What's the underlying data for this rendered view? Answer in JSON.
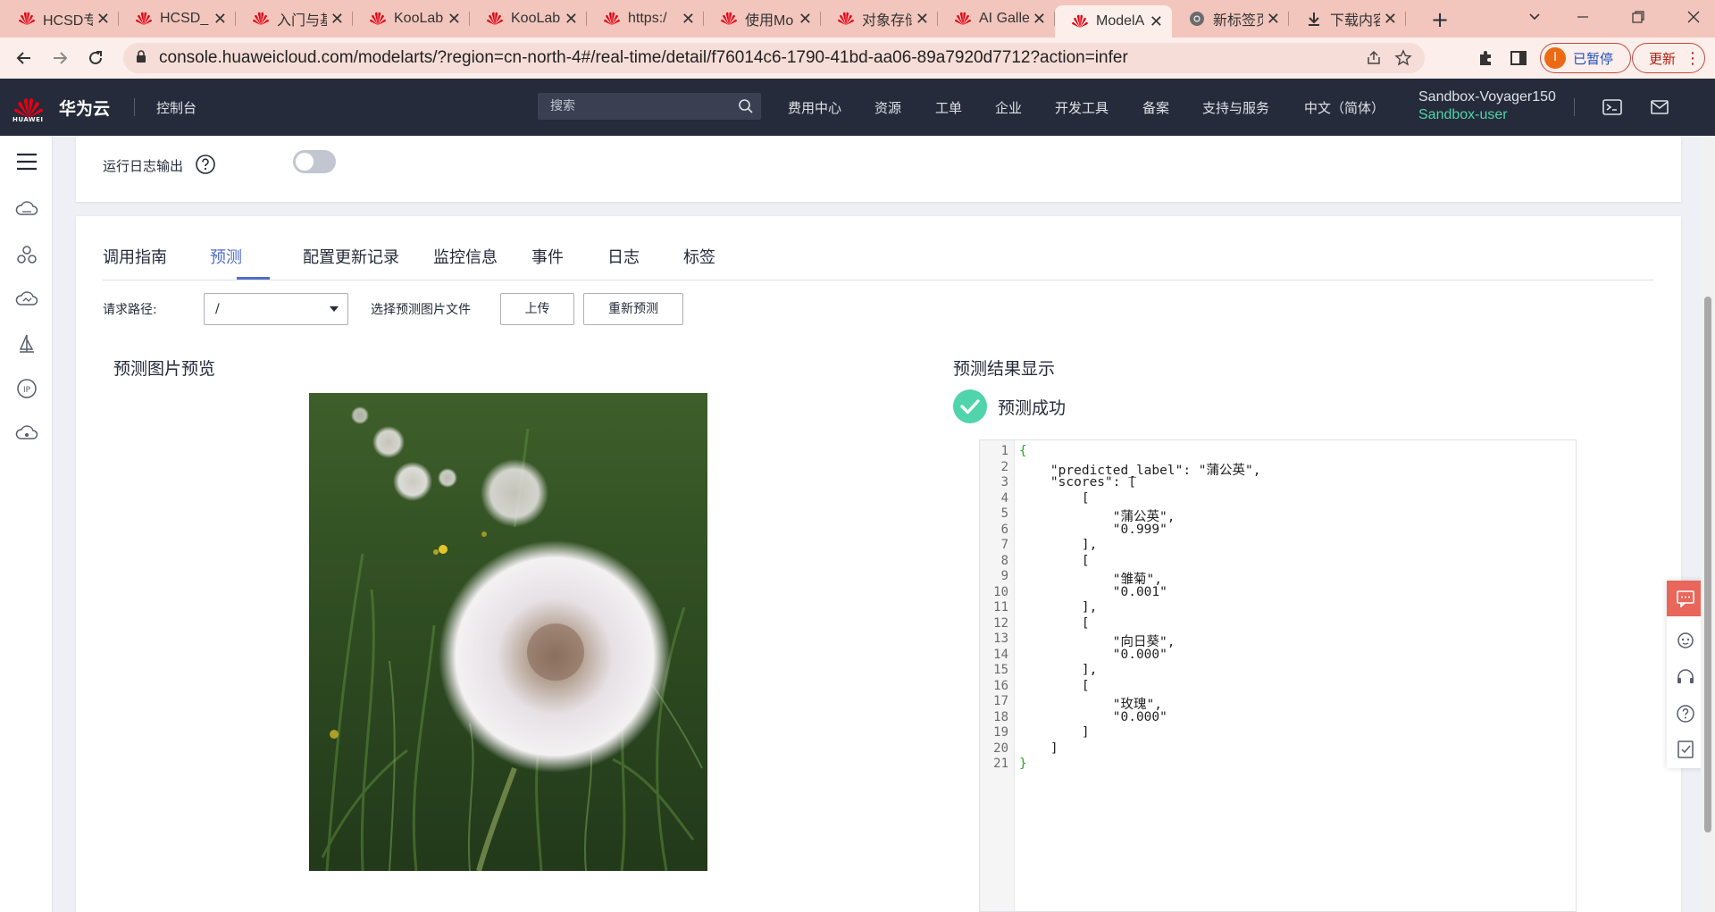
{
  "browser": {
    "tabs": [
      {
        "title": "HCSD专"
      },
      {
        "title": "HCSD_"
      },
      {
        "title": "入门与基"
      },
      {
        "title": "KooLab"
      },
      {
        "title": "KooLab"
      },
      {
        "title": "https:/"
      },
      {
        "title": "使用Mo"
      },
      {
        "title": "对象存储"
      },
      {
        "title": "AI Galle"
      },
      {
        "title": "ModelA"
      },
      {
        "title": "新标签页"
      },
      {
        "title": "下载内容"
      }
    ],
    "url": "console.huaweicloud.com/modelarts/?region=cn-north-4#/real-time/detail/f76014c6-1790-41bd-aa06-89a7920d7712?action=infer",
    "profile_initial": "I",
    "profile_status": "已暂停",
    "update_label": "更新"
  },
  "header": {
    "logo_text": "HUAWEI",
    "brand": "华为云",
    "console": "控制台",
    "search_placeholder": "搜索",
    "nav": [
      "费用中心",
      "资源",
      "工单",
      "企业",
      "开发工具",
      "备案",
      "支持与服务",
      "中文（简体）"
    ],
    "account_name": "Sandbox-Voyager150",
    "account_user": "Sandbox-user"
  },
  "log_output": {
    "label": "运行日志输出",
    "enabled": false
  },
  "tabs": [
    "调用指南",
    "预测",
    "配置更新记录",
    "监控信息",
    "事件",
    "日志",
    "标签"
  ],
  "active_tab": "预测",
  "request": {
    "path_label": "请求路径:",
    "path_value": "/",
    "choose_label": "选择预测图片文件",
    "upload_label": "上传",
    "repredict_label": "重新预测"
  },
  "preview": {
    "title": "预测图片预览"
  },
  "result": {
    "title": "预测结果显示",
    "status": "预测成功",
    "code_lines": [
      "{",
      "    \"predicted_label\": \"蒲公英\",",
      "    \"scores\": [",
      "        [",
      "            \"蒲公英\",",
      "            \"0.999\"",
      "        ],",
      "        [",
      "            \"雏菊\",",
      "            \"0.001\"",
      "        ],",
      "        [",
      "            \"向日葵\",",
      "            \"0.000\"",
      "        ],",
      "        [",
      "            \"玫瑰\",",
      "            \"0.000\"",
      "        ]",
      "    ]",
      "}"
    ]
  },
  "colors": {
    "accent": "#526ecc",
    "header_bg": "#252b3a",
    "success": "#50d4ab",
    "brace": "#2aa52a"
  }
}
